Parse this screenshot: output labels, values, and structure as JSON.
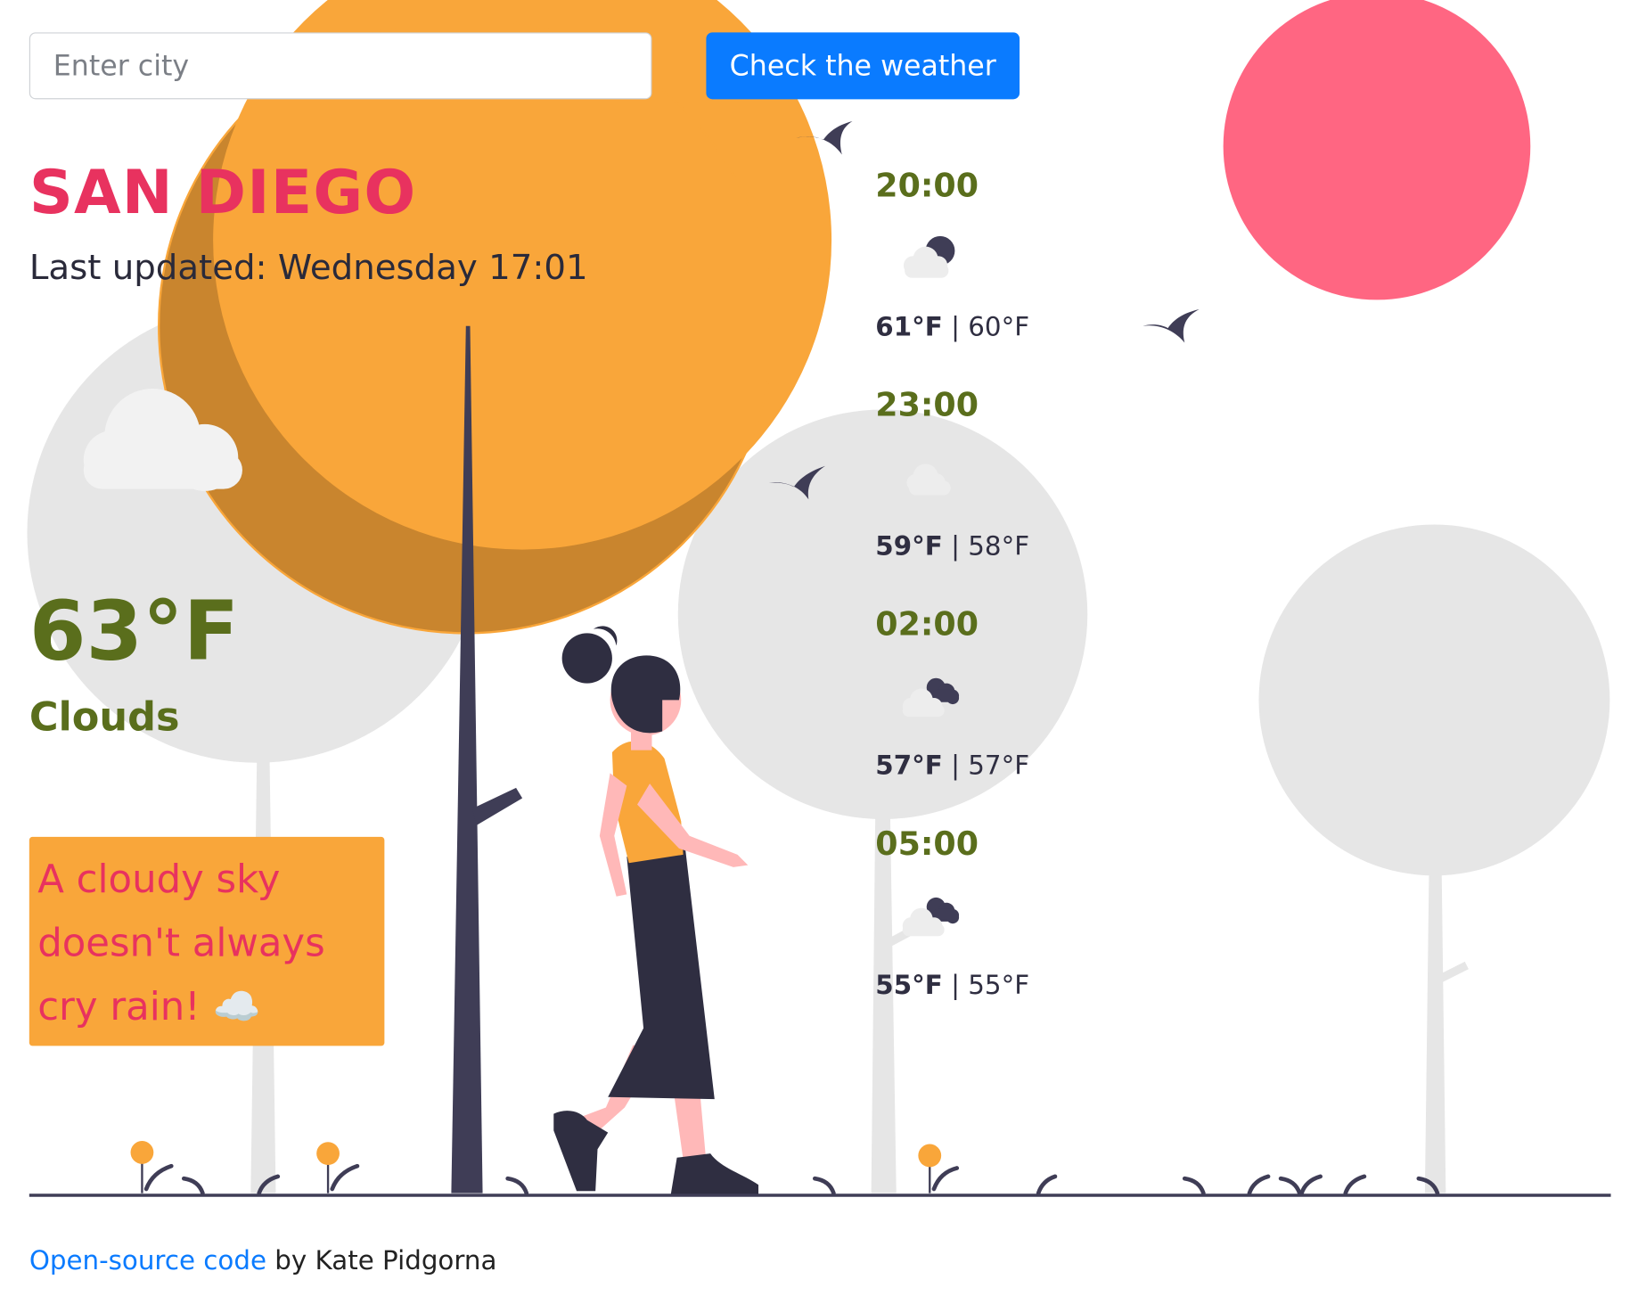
{
  "search": {
    "placeholder": "Enter city",
    "value": "",
    "button_label": "Check the weather"
  },
  "current": {
    "city": "SAN DIEGO",
    "last_updated": "Last updated: Wednesday 17:01",
    "temperature": "63°F",
    "description": "Clouds",
    "quote": "A cloudy sky doesn't always cry rain! ☁️"
  },
  "forecast": [
    {
      "time": "20:00",
      "icon": "night-cloud-icon",
      "max": "61°F",
      "min": "60°F"
    },
    {
      "time": "23:00",
      "icon": "cloud-icon",
      "max": "59°F",
      "min": "58°F"
    },
    {
      "time": "02:00",
      "icon": "broken-clouds-icon",
      "max": "57°F",
      "min": "57°F"
    },
    {
      "time": "05:00",
      "icon": "broken-clouds-icon",
      "max": "55°F",
      "min": "55°F"
    }
  ],
  "footer": {
    "link_label": "Open-source code",
    "suffix": " by Kate Pidgorna"
  },
  "colors": {
    "accent_blue": "#0a7bff",
    "city_pink": "#e8325f",
    "olive": "#5a6e1c",
    "sun_orange": "#f9a63a",
    "sun_pink": "#ff6682",
    "dark": "#2f2e41"
  }
}
